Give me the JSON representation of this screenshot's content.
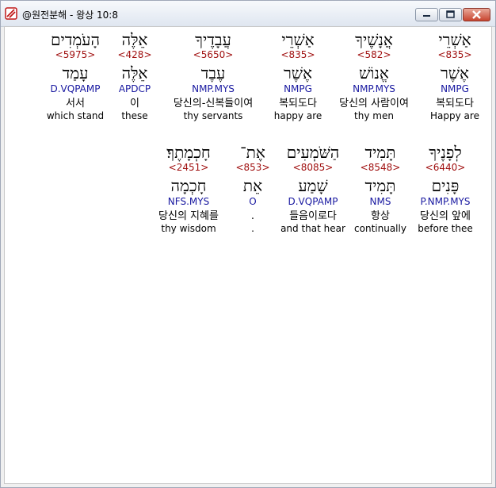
{
  "window": {
    "title": "@원전분해 - 왕상 10:8",
    "controls": {
      "minimize": "–",
      "maximize": "□",
      "close": "✕"
    }
  },
  "rows": [
    {
      "words": [
        {
          "heb": "אַשְׁרֵי",
          "strong": "<835>",
          "lemma": "אֶשֶׁר",
          "morph": "NMPG",
          "kor": "복되도다",
          "eng": "Happy are"
        },
        {
          "heb": "אֲנָשֶׁיךָ",
          "strong": "<582>",
          "lemma": "אֱנוֹשׁ",
          "morph": "NMP.MYS",
          "kor": "당신의 사람이여",
          "eng": "thy men"
        },
        {
          "heb": "אַשְׁרֵי",
          "strong": "<835>",
          "lemma": "אֶשֶׁר",
          "morph": "NMPG",
          "kor": "복되도다",
          "eng": "happy are"
        },
        {
          "heb": "עֲבָדֶיךָ",
          "strong": "<5650>",
          "lemma": "עֶבֶד",
          "morph": "NMP.MYS",
          "kor": "당신의-신복들이여",
          "eng": "thy servants"
        },
        {
          "heb": "אֵלֶּה",
          "strong": "<428>",
          "lemma": "אֵלֶּה",
          "morph": "APDCP",
          "kor": "이",
          "eng": "these"
        },
        {
          "heb": "הָעֹמְדִים",
          "strong": "<5975>",
          "lemma": "עָמַד",
          "morph": "D.VQPAMP",
          "kor": "서서",
          "eng": "which stand"
        }
      ]
    },
    {
      "words": [
        {
          "heb": "לְפָנֶיךָ",
          "strong": "<6440>",
          "lemma": "פָּנִים",
          "morph": "P.NMP.MYS",
          "kor": "당신의 앞에",
          "eng": "before thee"
        },
        {
          "heb": "תָּמִיד",
          "strong": "<8548>",
          "lemma": "תָּמִיד",
          "morph": "NMS",
          "kor": "항상",
          "eng": "continually"
        },
        {
          "heb": "הַשֹּׁמְעִים",
          "strong": "<8085>",
          "lemma": "שָׁמַע",
          "morph": "D.VQPAMP",
          "kor": "들음이로다",
          "eng": "and that hear"
        },
        {
          "heb": "אֶת־",
          "strong": "<853>",
          "lemma": "אֵת",
          "morph": "O",
          "kor": ".",
          "eng": "."
        },
        {
          "heb": "חָכְמָתֶךָ׃",
          "strong": "<2451>",
          "lemma": "חָכְמָה",
          "morph": "NFS.MYS",
          "kor": "당신의 지혜를",
          "eng": "thy wisdom"
        }
      ]
    }
  ]
}
